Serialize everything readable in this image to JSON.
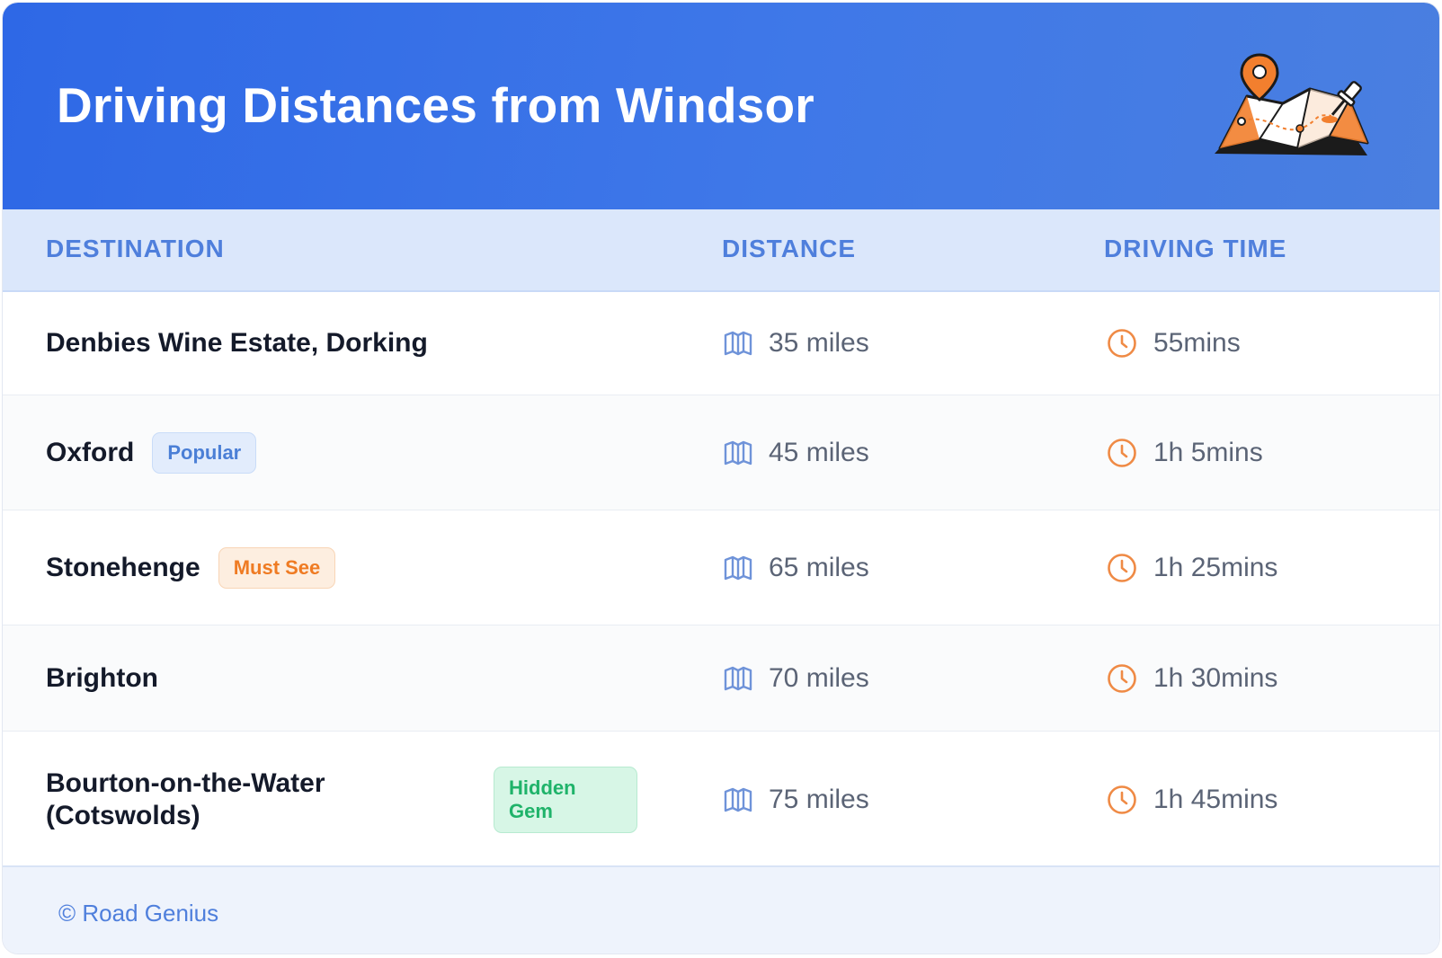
{
  "header": {
    "title": "Driving Distances from Windsor",
    "illustration": "map-with-pins-icon"
  },
  "columns": {
    "destination": "DESTINATION",
    "distance": "DISTANCE",
    "driving_time": "DRIVING TIME"
  },
  "rows": [
    {
      "destination": "Denbies Wine Estate, Dorking",
      "badge": null,
      "distance": "35 miles",
      "time": "55mins"
    },
    {
      "destination": "Oxford",
      "badge": "Popular",
      "distance": "45 miles",
      "time": "1h 5mins"
    },
    {
      "destination": "Stonehenge",
      "badge": "Must See",
      "distance": "65 miles",
      "time": "1h 25mins"
    },
    {
      "destination": "Brighton",
      "badge": null,
      "distance": "70 miles",
      "time": "1h 30mins"
    },
    {
      "destination": "Bourton-on-the-Water (Cotswolds)",
      "badge": "Hidden Gem",
      "distance": "75 miles",
      "time": "1h 45mins"
    }
  ],
  "icons": {
    "distance": "map-icon",
    "time": "clock-icon"
  },
  "colors": {
    "header_gradient_start": "#2e68e6",
    "header_gradient_end": "#4a7fe0",
    "accent_blue": "#4f7fdc",
    "accent_orange": "#ef7b23",
    "accent_green": "#1fb36a"
  },
  "footer": {
    "text": "© Road Genius"
  }
}
